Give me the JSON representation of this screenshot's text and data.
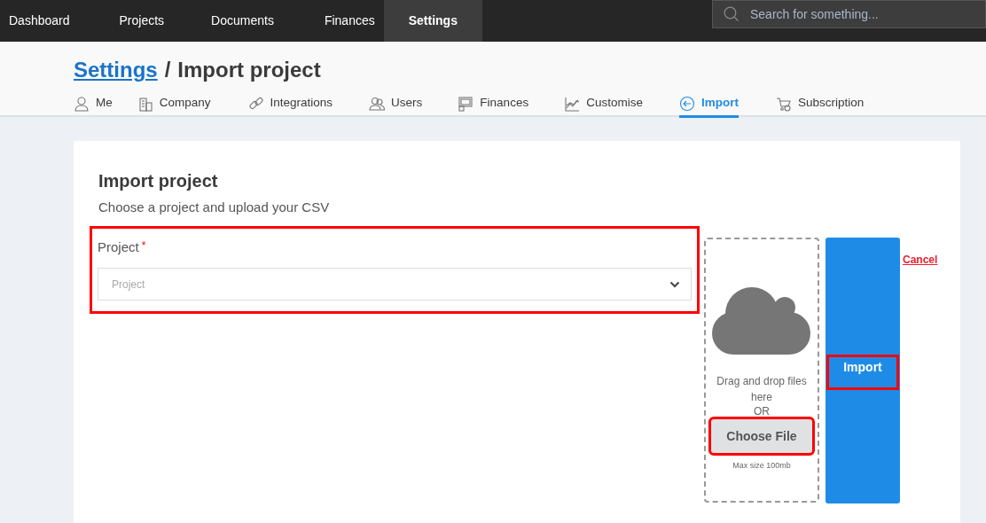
{
  "top_nav": {
    "items": [
      {
        "label": "Dashboard",
        "selected": false
      },
      {
        "label": "Projects",
        "selected": false
      },
      {
        "label": "Documents",
        "selected": false
      },
      {
        "label": "Finances",
        "selected": false
      },
      {
        "label": "Settings",
        "selected": true
      }
    ],
    "search": {
      "placeholder": "Search for something..."
    }
  },
  "header": {
    "breadcrumb_link": "Settings",
    "separator": "/",
    "title": "Import project"
  },
  "tabs": [
    {
      "label": "Me",
      "kind": "person",
      "selected": false
    },
    {
      "label": "Company",
      "kind": "building",
      "selected": false
    },
    {
      "label": "Integrations",
      "kind": "link",
      "selected": false
    },
    {
      "label": "Users",
      "kind": "users",
      "selected": false
    },
    {
      "label": "Finances",
      "kind": "finance",
      "selected": false
    },
    {
      "label": "Customise",
      "kind": "chart",
      "selected": false
    },
    {
      "label": "Import",
      "kind": "import",
      "selected": true
    },
    {
      "label": "Subscription",
      "kind": "cart",
      "selected": false
    }
  ],
  "form": {
    "title": "Import project",
    "subtitle": "Choose a project and upload your CSV",
    "project_field": {
      "label": "Project",
      "required_mark": "*",
      "placeholder": "Project",
      "highlighted": true
    },
    "upload": {
      "hint": "Drag and drop files here",
      "or": "OR",
      "button": "Choose File",
      "button_highlighted": true,
      "max_size": "Max size 100mb"
    },
    "import_button": {
      "label": "Import",
      "highlighted": true
    },
    "cancel": "Cancel"
  }
}
